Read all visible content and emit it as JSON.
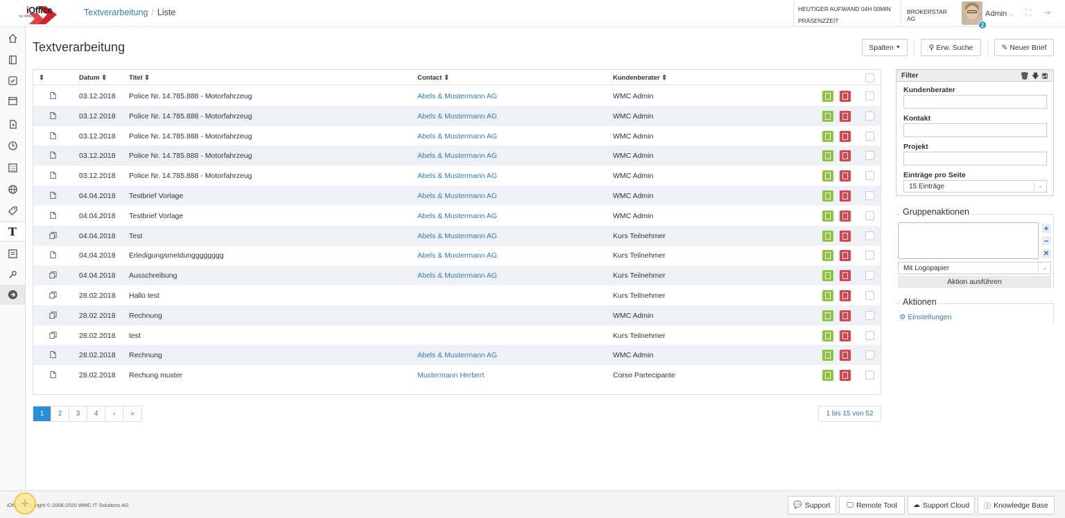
{
  "header": {
    "logo_text": "iOffice",
    "logo_sub": "by WMC",
    "breadcrumb_link": "Textverarbeitung",
    "breadcrumb_sep": "/",
    "breadcrumb_current": "Liste",
    "effort_line1": "HEUTIGER AUFWAND 04H 00MIN",
    "effort_line2": "PRÄSENZZEIT",
    "company": "BROKERSTAR AG",
    "user_name": "Admin",
    "notification_count": "2"
  },
  "page": {
    "title": "Textverarbeitung",
    "btn_columns": "Spalten",
    "btn_search": "Erw. Suche",
    "btn_new": "Neuer Brief"
  },
  "table": {
    "headers": {
      "sort": "⇕",
      "date": "Datum ⇕",
      "title": "Titel ⇕",
      "contact": "Contact ⇕",
      "advisor": "Kundenberater ⇕"
    },
    "rows": [
      {
        "icon": "file",
        "date": "03.12.2018",
        "title": "Police Nr. 14.785.888 - Motorfahrzeug",
        "contact": "Abels & Mustermann AG",
        "advisor": "WMC Admin"
      },
      {
        "icon": "file",
        "date": "03.12.2018",
        "title": "Police Nr. 14.785.888 - Motorfahrzeug",
        "contact": "Abels & Mustermann AG",
        "advisor": "WMC Admin"
      },
      {
        "icon": "file",
        "date": "03.12.2018",
        "title": "Police Nr. 14.785.888 - Motorfahrzeug",
        "contact": "Abels & Mustermann AG",
        "advisor": "WMC Admin"
      },
      {
        "icon": "file",
        "date": "03.12.2018",
        "title": "Police Nr. 14.785.888 - Motorfahrzeug",
        "contact": "Abels & Mustermann AG",
        "advisor": "WMC Admin"
      },
      {
        "icon": "file",
        "date": "03.12.2018",
        "title": "Police Nr. 14.785.888 - Motorfahrzeug",
        "contact": "Abels & Mustermann AG",
        "advisor": "WMC Admin"
      },
      {
        "icon": "file",
        "date": "04.04.2018",
        "title": "Testbrief Vorlage",
        "contact": "Abels & Mustermann AG",
        "advisor": "WMC Admin"
      },
      {
        "icon": "file",
        "date": "04.04.2018",
        "title": "Testbrief Vorlage",
        "contact": "Abels & Mustermann AG",
        "advisor": "WMC Admin"
      },
      {
        "icon": "copy",
        "date": "04.04.2018",
        "title": "Test",
        "contact": "Abels & Mustermann AG",
        "advisor": "Kurs Teilnehmer"
      },
      {
        "icon": "file",
        "date": "04.04.2018",
        "title": "Erledigungsmeldungggggggg",
        "contact": "Abels & Mustermann AG",
        "advisor": "Kurs Teilnehmer"
      },
      {
        "icon": "copy",
        "date": "04.04.2018",
        "title": "Ausschreibung",
        "contact": "Abels & Mustermann AG",
        "advisor": "Kurs Teilnehmer"
      },
      {
        "icon": "copy",
        "date": "28.02.2018",
        "title": "Hallo test",
        "contact": "",
        "advisor": "Kurs Teilnehmer"
      },
      {
        "icon": "copy",
        "date": "28.02.2018",
        "title": "Rechnung",
        "contact": "",
        "advisor": "WMC Admin"
      },
      {
        "icon": "copy",
        "date": "28.02.2018",
        "title": "test",
        "contact": "",
        "advisor": "Kurs Teilnehmer"
      },
      {
        "icon": "file",
        "date": "28.02.2018",
        "title": "Rechnung",
        "contact": "Abels & Mustermann AG",
        "advisor": "WMC Admin"
      },
      {
        "icon": "file",
        "date": "28.02.2018",
        "title": "Rechung muster",
        "contact": "Mustermann Herbert",
        "advisor": "Corso Partecipante"
      }
    ]
  },
  "pagination": {
    "pages": [
      "1",
      "2",
      "3",
      "4",
      "›",
      "»"
    ],
    "active": "1",
    "count_text": "1 bis 15 von 52"
  },
  "filter": {
    "title": "Filter",
    "label_advisor": "Kundenberater",
    "label_contact": "Kontakt",
    "label_project": "Projekt",
    "label_per_page": "Einträge pro Seite",
    "per_page_value": "15 Einträge"
  },
  "group_actions": {
    "title": "Gruppenaktionen",
    "select_value": "Mit Logopapier",
    "execute_label": "Aktion ausführen"
  },
  "actions": {
    "title": "Aktionen",
    "settings_label": "Einstellungen"
  },
  "footer": {
    "copyright": "iOffice Copyright © 2008-2020 WMC IT Solutions AG",
    "support": "Support",
    "remote": "Remote Tool",
    "cloud": "Support Cloud",
    "kb": "Knowledge Base"
  },
  "colors": {
    "link": "#337ab7",
    "accent": "#2a8fd8",
    "pdf_green": "#8dc43f",
    "pdf_red": "#e0414f",
    "row_alt": "#eef2f7"
  }
}
